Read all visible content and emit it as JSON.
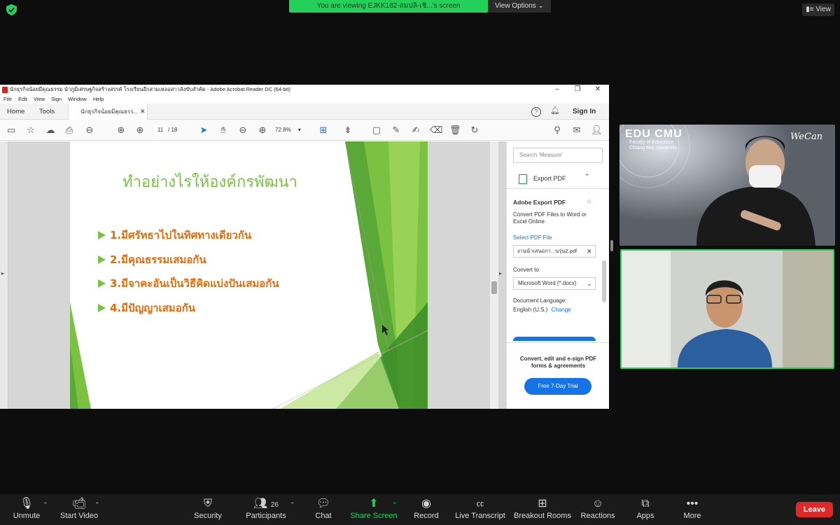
{
  "top": {
    "banner": "You are viewing EJKK182-สมปลิ-เชิ...'s screen",
    "view_options": "View Options ⌄",
    "view": "View"
  },
  "acrobat": {
    "title": "นักธุรกิจน้อยมีคุณธรรม  นำภูมิเศรษฐกิจสร้างสรรค์ โรงเรียนอีกสามเหลอสาวลังขับสำคัด - Adobe Acrobat Reader DC (64-bit)",
    "menu": [
      "File",
      "Edit",
      "View",
      "Sign",
      "Window",
      "Help"
    ],
    "tab_home": "Home",
    "tab_tools": "Tools",
    "tab_doc": "นักธุรกิจน้อยมีคุณธรร...",
    "sign_in": "Sign In",
    "page_current": "11",
    "page_total": "/ 18",
    "zoom": "72.8%"
  },
  "slide": {
    "title": "ทำอย่างไรให้องค์กรพัฒนา",
    "bullets": [
      "1.มีศรัทธาไปในทิศทางเดียวกัน",
      "2.มีคุณธรรมเสมอกัน",
      "3.มีจาคะอันเป็นวิธีคิดแบ่งปันเสมอกัน",
      "4.มีปัญญาเสมอกัน"
    ]
  },
  "side_panel": {
    "search_placeholder": "Search 'Measure'",
    "export_pdf": "Export PDF",
    "adobe_export": "Adobe Export PDF",
    "convert_desc": "Convert PDF Files to Word or Excel Online",
    "select_file": "Select PDF File",
    "file_name": "งานนำเสนอกา...นรุ่น2.pdf",
    "convert_to": "Convert to",
    "convert_value": "Microsoft Word (*.docx)",
    "doc_language": "Document Language:",
    "language": "English (U.S.)",
    "change": "Change",
    "promo": "Convert, edit and e-sign PDF forms & agreements",
    "trial": "Free 7-Day Trial"
  },
  "video1": {
    "brand": "EDU CMU",
    "faculty": "Faculty of Education",
    "university": "Chiang Mai University",
    "we_can": "WeCan"
  },
  "controls": {
    "unmute": "Unmute",
    "start_video": "Start Video",
    "security": "Security",
    "participants": "Participants",
    "participants_count": "26",
    "chat": "Chat",
    "share_screen": "Share Screen",
    "record": "Record",
    "live_transcript": "Live Transcript",
    "breakout_rooms": "Breakout Rooms",
    "reactions": "Reactions",
    "apps": "Apps",
    "more": "More",
    "leave": "Leave"
  },
  "colors": {
    "zoom_green": "#23d159",
    "slide_green": "#7cc242",
    "slide_orange": "#e46c0a",
    "leave_red": "#e02828",
    "adobe_blue": "#1473e6"
  }
}
